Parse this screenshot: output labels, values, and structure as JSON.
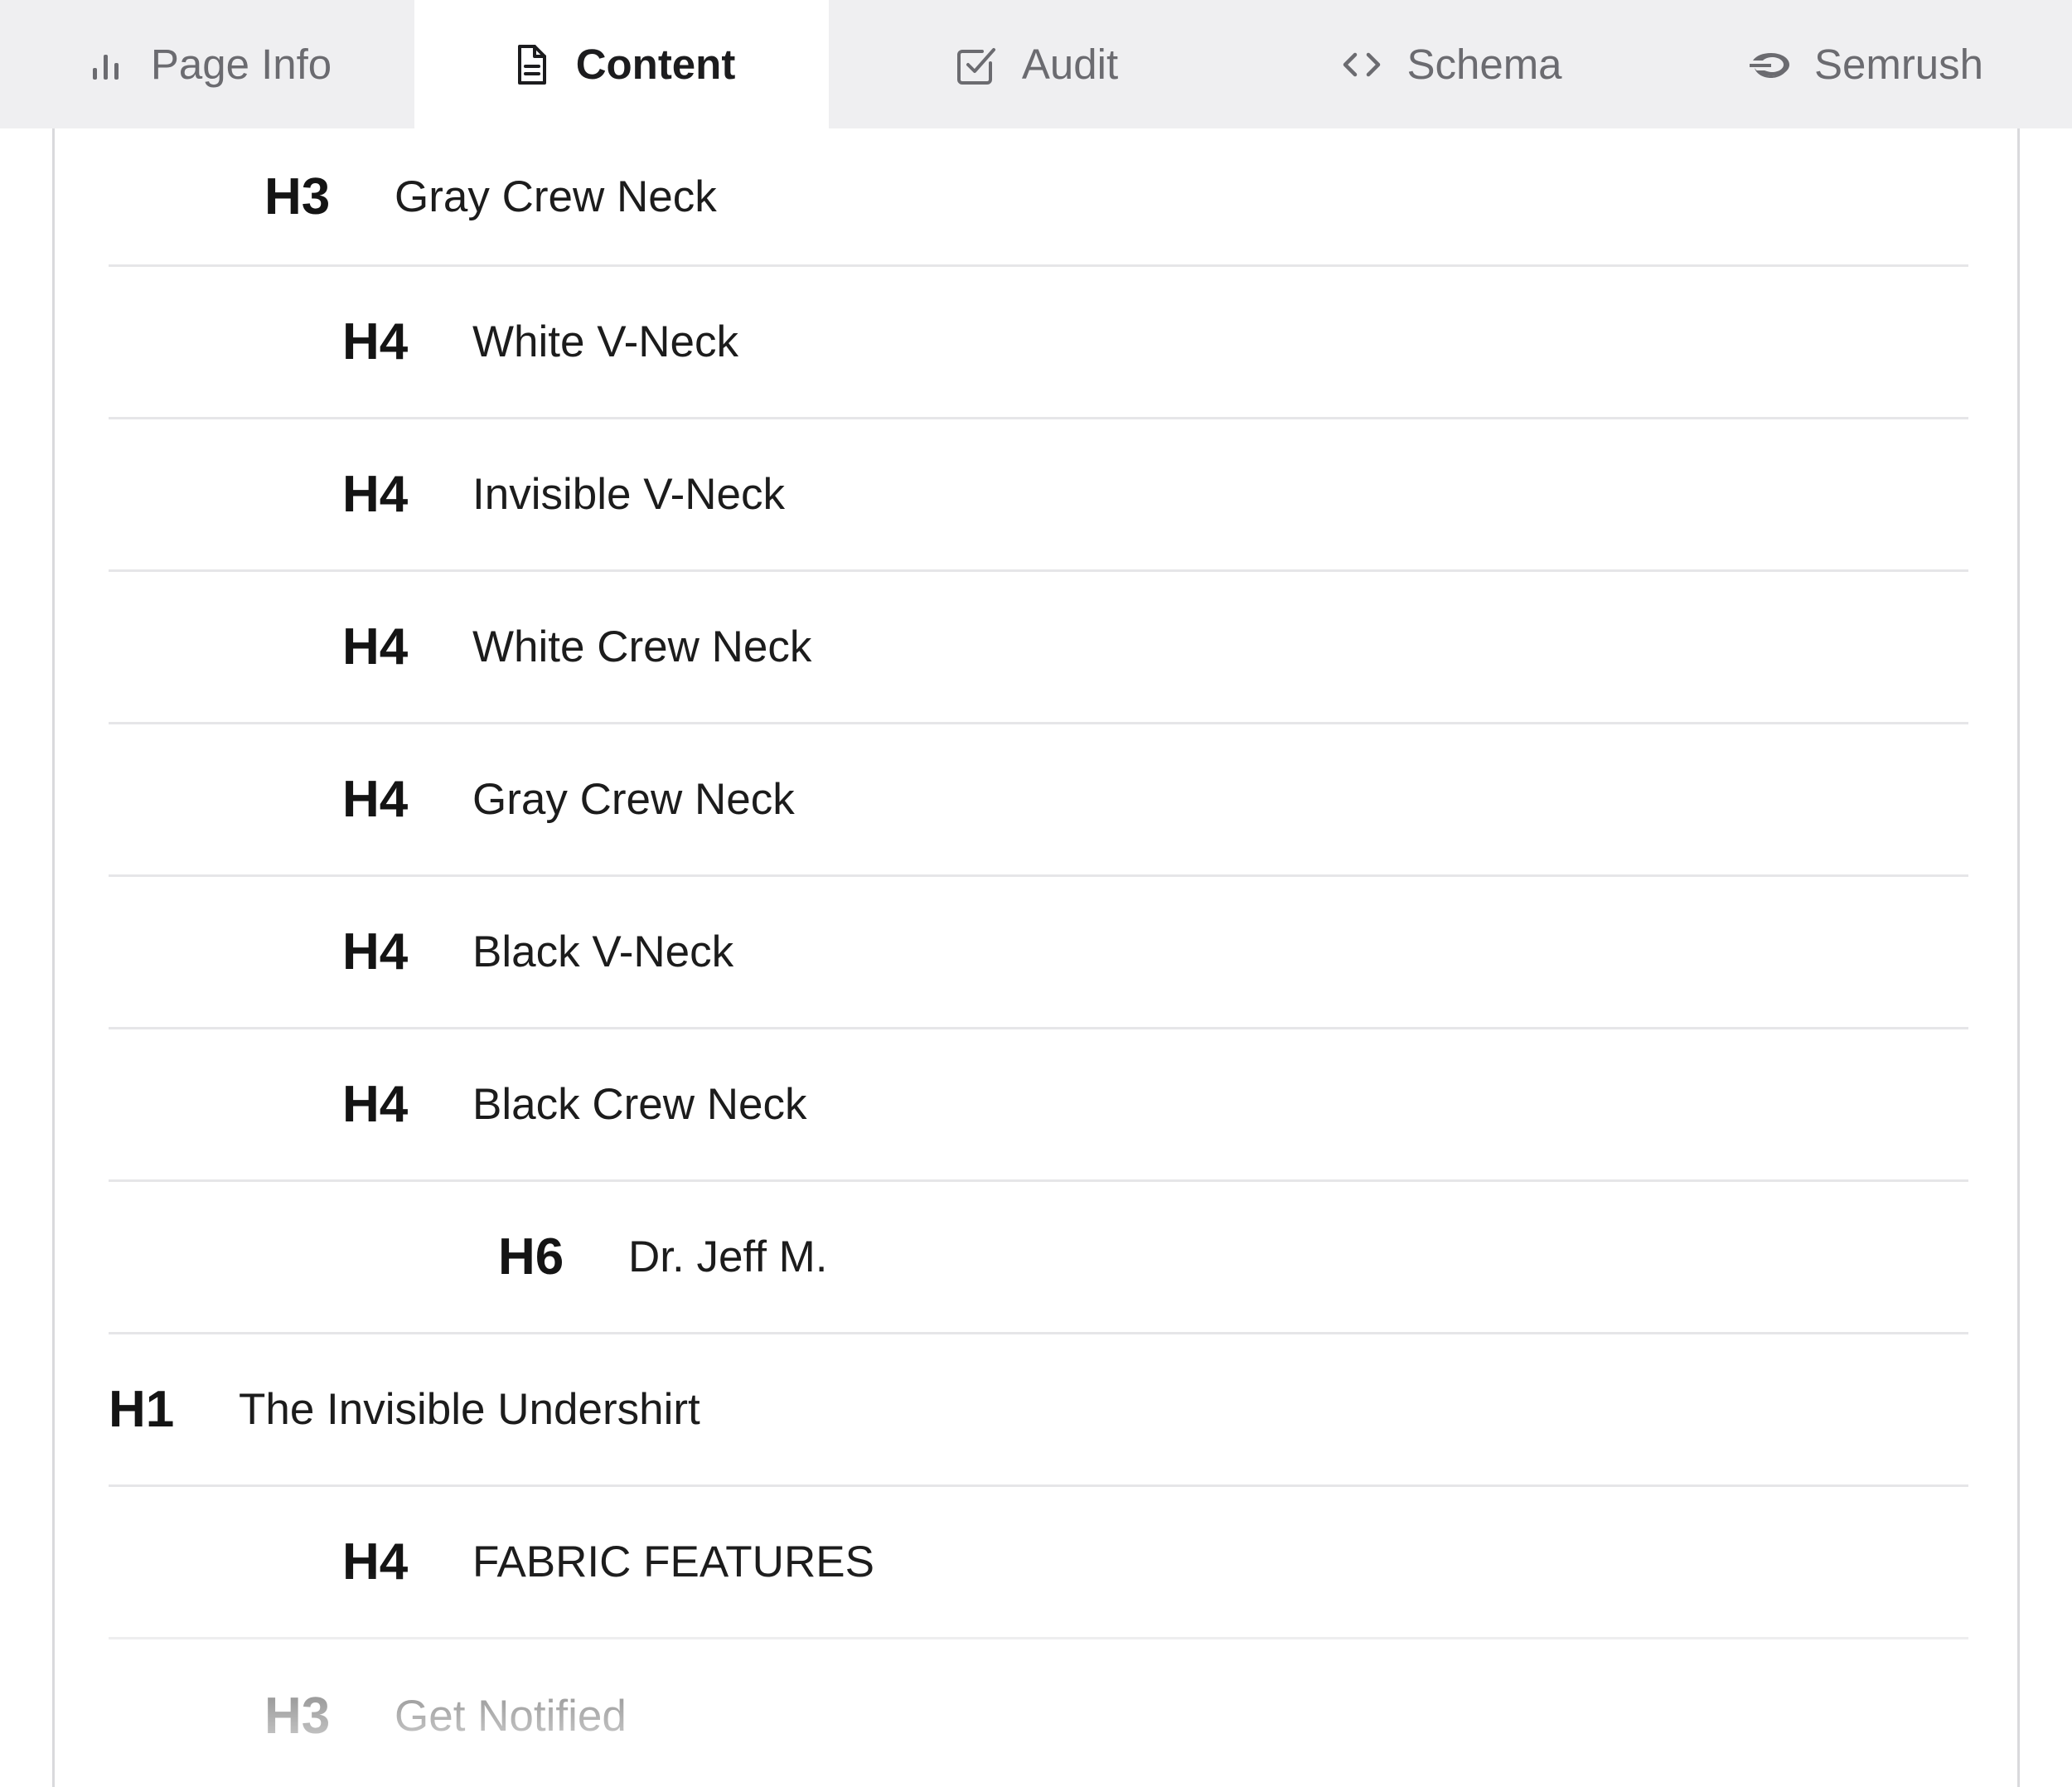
{
  "tabs": [
    {
      "label": "Page Info",
      "icon": "bar-chart-icon",
      "active": false
    },
    {
      "label": "Content",
      "icon": "document-icon",
      "active": true
    },
    {
      "label": "Audit",
      "icon": "checkbox-icon",
      "active": false
    },
    {
      "label": "Schema",
      "icon": "code-brackets-icon",
      "active": false
    },
    {
      "label": "Semrush",
      "icon": "semrush-logo-icon",
      "active": false
    }
  ],
  "headings": [
    {
      "tag": "H3",
      "text": "Gray Crew Neck"
    },
    {
      "tag": "H4",
      "text": "White V-Neck"
    },
    {
      "tag": "H4",
      "text": "Invisible V-Neck"
    },
    {
      "tag": "H4",
      "text": "White Crew Neck"
    },
    {
      "tag": "H4",
      "text": "Gray Crew Neck"
    },
    {
      "tag": "H4",
      "text": "Black V-Neck"
    },
    {
      "tag": "H4",
      "text": "Black Crew Neck"
    },
    {
      "tag": "H6",
      "text": "Dr. Jeff M."
    },
    {
      "tag": "H1",
      "text": "The Invisible Undershirt"
    },
    {
      "tag": "H4",
      "text": "FABRIC FEATURES"
    },
    {
      "tag": "H3",
      "text": "Get Notified"
    }
  ],
  "colors": {
    "tab_bar_bg": "#efeff1",
    "active_tab_bg": "#ffffff",
    "divider": "#e6e6e8"
  }
}
